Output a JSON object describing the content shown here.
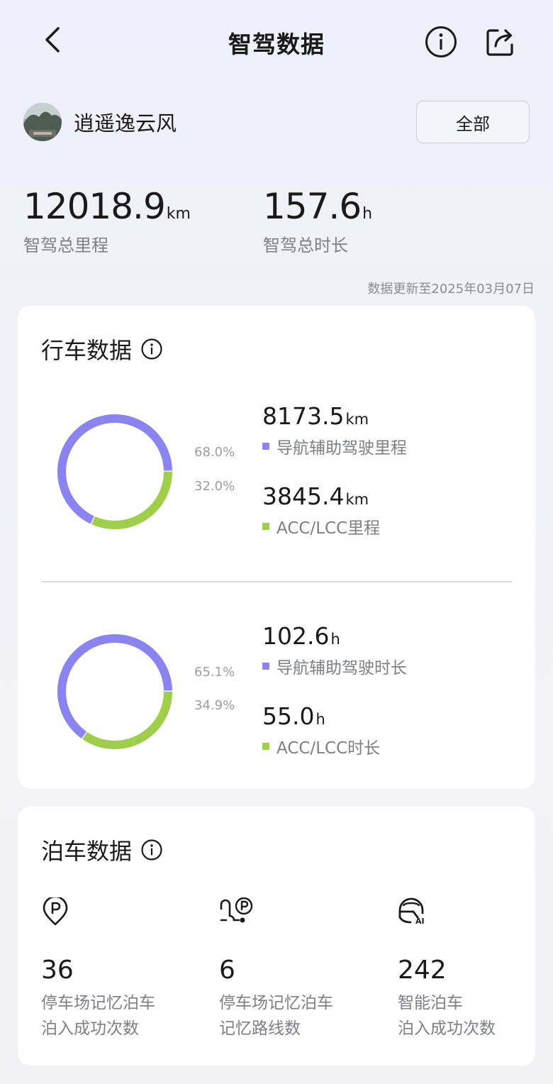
{
  "header": {
    "title": "智驾数据",
    "icons": [
      "chevron-left-icon",
      "info-circle-icon",
      "share-icon"
    ]
  },
  "profile": {
    "username": "逍遥逸云风",
    "filter_label": "全部"
  },
  "summary": {
    "distance_value": "12018.9",
    "distance_unit": "km",
    "distance_label": "智驾总里程",
    "duration_value": "157.6",
    "duration_unit": "h",
    "duration_label": "智驾总时长",
    "update_note": "数据更新至2025年03月07日"
  },
  "colors": {
    "nav": "#8b84ee",
    "acc": "#9fcf4a",
    "track": "#e6e6ee"
  },
  "driving": {
    "title": "行车数据",
    "mileage": {
      "nav_pct_label": "68.0%",
      "acc_pct_label": "32.0%",
      "nav_fraction": 0.68,
      "nav_value": "8173.5",
      "nav_unit": "km",
      "nav_label": "导航辅助驾驶里程",
      "acc_value": "3845.4",
      "acc_unit": "km",
      "acc_label": "ACC/LCC里程"
    },
    "duration": {
      "nav_pct_label": "65.1%",
      "acc_pct_label": "34.9%",
      "nav_fraction": 0.651,
      "nav_value": "102.6",
      "nav_unit": "h",
      "nav_label": "导航辅助驾驶时长",
      "acc_value": "55.0",
      "acc_unit": "h",
      "acc_label": "ACC/LCC时长"
    }
  },
  "parking": {
    "title": "泊车数据",
    "items": [
      {
        "icon": "parking-pin-icon",
        "value": "36",
        "line1": "停车场记忆泊车",
        "line2": "泊入成功次数"
      },
      {
        "icon": "parking-route-icon",
        "value": "6",
        "line1": "停车场记忆泊车",
        "line2": "记忆路线数"
      },
      {
        "icon": "ai-parking-icon",
        "value": "242",
        "line1": "智能泊车",
        "line2": "泊入成功次数"
      }
    ]
  }
}
